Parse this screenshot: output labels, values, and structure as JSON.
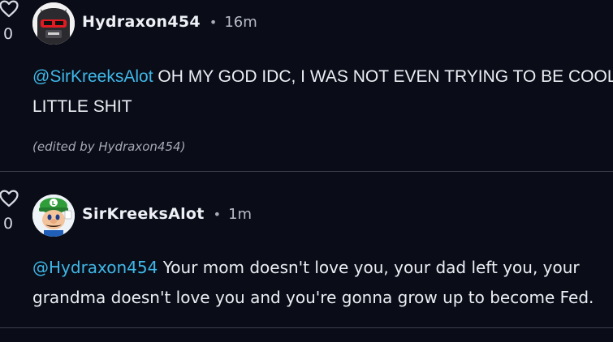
{
  "comments": [
    {
      "likes": "0",
      "author": "Hydraxon454",
      "separator": "•",
      "time": "16m",
      "mention": "@SirKreeksAlot",
      "text_line1": " OH MY GOD IDC, I WAS NOT EVEN TRYING TO BE COOL",
      "text_line2": "LITTLE SHIT",
      "edited_note": "(edited by Hydraxon454)",
      "avatar_icon": "robot-visor-avatar-icon"
    },
    {
      "likes": "0",
      "author": "SirKreeksAlot",
      "separator": "•",
      "time": "1m",
      "mention": "@Hydraxon454",
      "text_line1": " Your mom doesn't love you, your dad left you, your",
      "text_line2": "grandma doesn't love you and you're gonna grow up to become Fed.",
      "avatar_icon": "luigi-avatar-icon"
    }
  ],
  "colors": {
    "background": "#0a0c17",
    "mention": "#3fb8e8",
    "divider": "#3b3f4c"
  }
}
